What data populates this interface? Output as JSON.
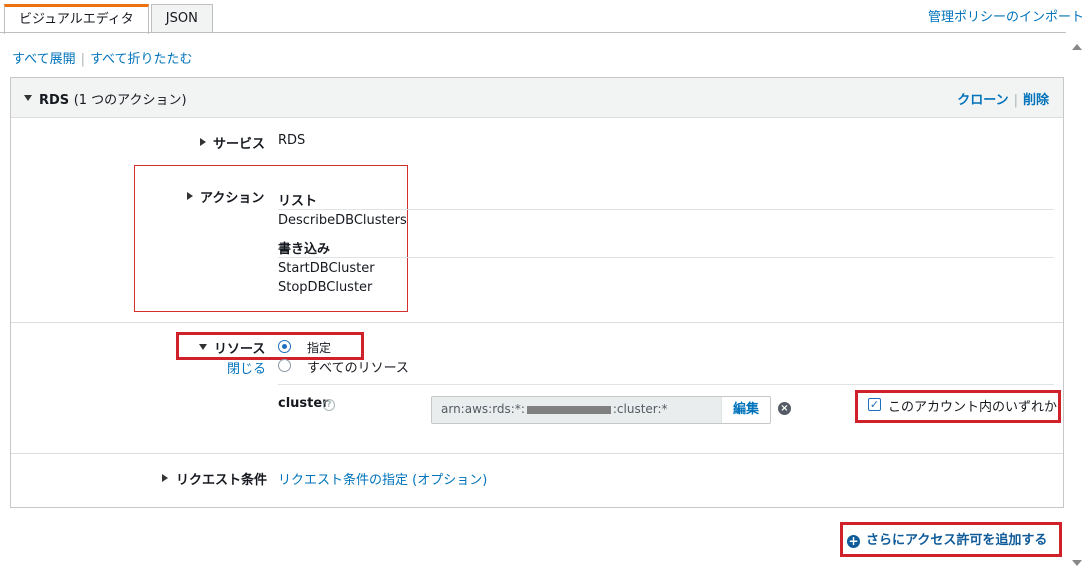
{
  "tabs": [
    {
      "label": "ビジュアルエディタ",
      "active": true
    },
    {
      "label": "JSON",
      "active": false
    }
  ],
  "import_link": "管理ポリシーのインポート",
  "expand_all": "すべて展開",
  "collapse_all": "すべて折りたたむ",
  "panel": {
    "title": "RDS",
    "action_count": "(1 つのアクション)",
    "clone": "クローン",
    "delete": "削除"
  },
  "service": {
    "label": "サービス",
    "value": "RDS"
  },
  "actions": {
    "label": "アクション",
    "groups": [
      {
        "heading": "リスト",
        "items": [
          "DescribeDBClusters"
        ]
      },
      {
        "heading": "書き込み",
        "items": [
          "StartDBCluster",
          "StopDBCluster"
        ]
      }
    ]
  },
  "resources": {
    "label": "リソース",
    "close": "閉じる",
    "option_specific": "指定",
    "option_all": "すべてのリソース",
    "selected": "specific",
    "resource_type": "cluster",
    "help": "?",
    "arn_prefix": "arn:aws:rds:*:",
    "arn_suffix": ":cluster:*",
    "edit": "編集",
    "any_in_account": "このアカウント内のいずれか",
    "any_in_account_checked": true
  },
  "conditions": {
    "label": "リクエスト条件",
    "link": "リクエスト条件の指定 (オプション)"
  },
  "add_permissions": "さらにアクセス許可を追加する",
  "icons": {
    "clear": "x-circle-icon",
    "add": "plus-circle-icon",
    "check": "checkmark-icon"
  },
  "colors": {
    "link": "#0073bb",
    "tab_accent": "#ec7211",
    "highlight": "#d0202a",
    "button_text": "#0f5b9a"
  }
}
